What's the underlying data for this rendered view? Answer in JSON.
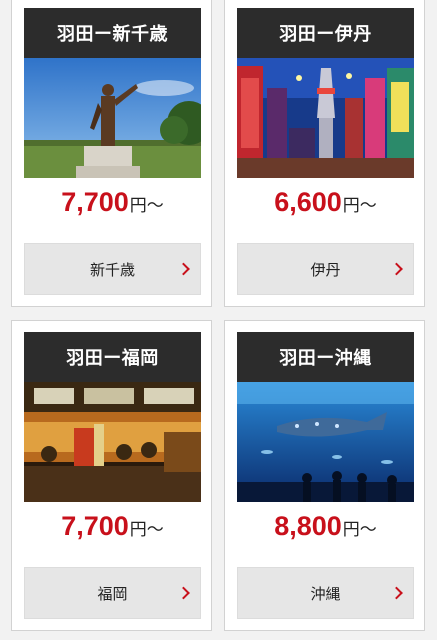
{
  "colors": {
    "accent": "#c8101b",
    "header_bg": "#2c2c2c",
    "button_bg": "#e6e6e6"
  },
  "cards": [
    {
      "title": "羽田ー新千歳",
      "price": "7,700",
      "unit": "円〜",
      "button": "新千歳",
      "photo": "sapporo-clark-statue-photo"
    },
    {
      "title": "羽田ー伊丹",
      "price": "6,600",
      "unit": "円〜",
      "button": "伊丹",
      "photo": "osaka-tsutenkaku-photo"
    },
    {
      "title": "羽田ー福岡",
      "price": "7,700",
      "unit": "円〜",
      "button": "福岡",
      "photo": "fukuoka-yatai-photo"
    },
    {
      "title": "羽田ー沖縄",
      "price": "8,800",
      "unit": "円〜",
      "button": "沖縄",
      "photo": "okinawa-aquarium-photo"
    }
  ]
}
